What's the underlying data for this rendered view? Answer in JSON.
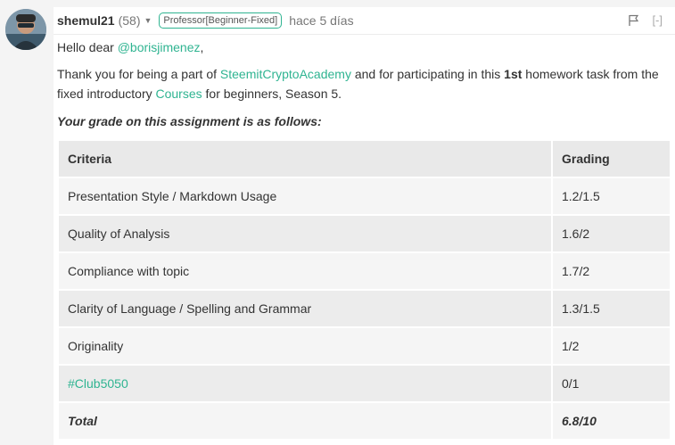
{
  "comment": {
    "author": "shemul21",
    "reputation": "(58)",
    "badge": "Professor[Beginner-Fixed]",
    "time": "hace 5 días",
    "collapse_label": "[-]",
    "greeting_prefix": "Hello dear ",
    "mention": "@borisjimenez",
    "greeting_suffix": ",",
    "p2_a": "Thank you for being a part of ",
    "p2_link": "SteemitCryptoAcademy",
    "p2_b": " and for participating in this ",
    "p2_bold": "1st",
    "p2_c": " homework task from the fixed introductory ",
    "p2_link2": "Courses",
    "p2_d": " for beginners, Season 5.",
    "grade_intro": "Your grade on this assignment is as follows:"
  },
  "table": {
    "headers": [
      "Criteria",
      "Grading"
    ],
    "rows": [
      [
        "Presentation Style / Markdown Usage",
        "1.2/1.5"
      ],
      [
        "Quality of Analysis",
        "1.6/2"
      ],
      [
        "Compliance with topic",
        "1.7/2"
      ],
      [
        "Clarity of Language / Spelling and Grammar",
        "1.3/1.5"
      ],
      [
        "Originality",
        "1/2"
      ],
      [
        "#Club5050",
        "0/1"
      ],
      [
        "Total",
        "6.8/10"
      ]
    ]
  },
  "colors": {
    "accent": "#2fb491"
  }
}
